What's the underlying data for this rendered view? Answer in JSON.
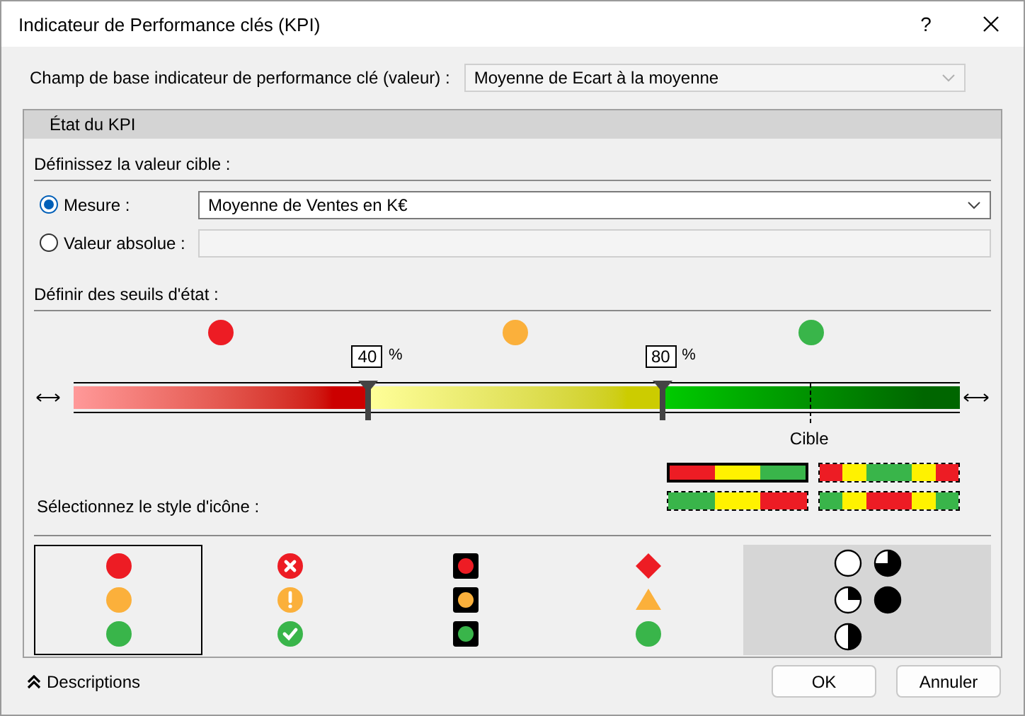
{
  "window": {
    "title": "Indicateur de Performance clés (KPI)",
    "help": "?"
  },
  "base_field": {
    "label": "Champ de base indicateur de performance clé (valeur) :",
    "value": "Moyenne de Ecart à la moyenne",
    "disabled": true
  },
  "section_tab": "État du KPI",
  "target": {
    "heading": "Définissez la valeur cible :",
    "options": [
      {
        "label": "Mesure :",
        "selected": true,
        "kind": "dropdown",
        "value": "Moyenne de Ventes en K€",
        "disabled": false
      },
      {
        "label": "Valeur absolue :",
        "selected": false,
        "kind": "text",
        "disabled": true
      }
    ]
  },
  "thresholds": {
    "heading": "Définir des seuils d'état :",
    "bands": [
      {
        "color": "#cc0000"
      },
      {
        "color": "#cccc00"
      },
      {
        "color": "#006600"
      }
    ],
    "dots": [
      {
        "color": "#ed1c24"
      },
      {
        "color": "#fbb03b"
      },
      {
        "color": "#39b54a"
      }
    ],
    "handles": [
      {
        "value": "40",
        "unit": "%",
        "level": 0.333
      },
      {
        "value": "80",
        "unit": "%",
        "level": 0.664
      }
    ],
    "target": {
      "label": "Cible",
      "level": 0.83
    }
  },
  "bar_styles": [
    {
      "selected": true,
      "segments": [
        {
          "color": "#ed1c24"
        },
        {
          "color": "#fff200"
        },
        {
          "color": "#39b54a"
        }
      ]
    },
    {
      "selected": false,
      "segments": [
        {
          "color": "#ed1c24"
        },
        {
          "color": "#fff200"
        },
        {
          "color": "#39b54a"
        },
        {
          "color": "#39b54a"
        },
        {
          "color": "#fff200"
        },
        {
          "color": "#ed1c24"
        }
      ]
    },
    {
      "selected": false,
      "segments": [
        {
          "color": "#39b54a"
        },
        {
          "color": "#fff200"
        },
        {
          "color": "#ed1c24"
        }
      ]
    },
    {
      "selected": false,
      "segments": [
        {
          "color": "#39b54a"
        },
        {
          "color": "#fff200"
        },
        {
          "color": "#ed1c24"
        },
        {
          "color": "#ed1c24"
        },
        {
          "color": "#fff200"
        },
        {
          "color": "#39b54a"
        }
      ]
    }
  ],
  "icon_style_heading": "Sélectionnez le style d'icône :",
  "icon_sets": [
    {
      "kind": "dot",
      "selected": true,
      "hovered": false,
      "icons": [
        {
          "color": "#ed1c24"
        },
        {
          "color": "#fbb03b"
        },
        {
          "color": "#39b54a"
        }
      ]
    },
    {
      "kind": "symbol",
      "selected": false,
      "hovered": false,
      "icons": [
        {
          "kind": "cross",
          "color": "#ed1c24"
        },
        {
          "kind": "exclamation",
          "color": "#fbb03b"
        },
        {
          "kind": "check",
          "color": "#39b54a"
        }
      ]
    },
    {
      "kind": "light",
      "selected": false,
      "hovered": false,
      "icons": [
        {
          "color": "#ed1c24"
        },
        {
          "color": "#fbb03b"
        },
        {
          "color": "#39b54a"
        }
      ]
    },
    {
      "kind": "shape",
      "selected": false,
      "hovered": false,
      "icons": [
        {
          "kind": "diamond",
          "color": "#ed1c24"
        },
        {
          "kind": "triangle",
          "color": "#fbb03b"
        },
        {
          "kind": "circle",
          "color": "#39b54a"
        }
      ]
    },
    {
      "kind": "quarters",
      "selected": false,
      "hovered": true,
      "icons": [
        {
          "kind": "empty"
        },
        {
          "kind": "three_quarters"
        },
        {
          "kind": "quarter"
        },
        {
          "kind": "full"
        },
        {
          "kind": "half"
        }
      ]
    }
  ],
  "footer": {
    "descriptions": "Descriptions",
    "buttons": [
      "OK",
      "Annuler"
    ]
  }
}
